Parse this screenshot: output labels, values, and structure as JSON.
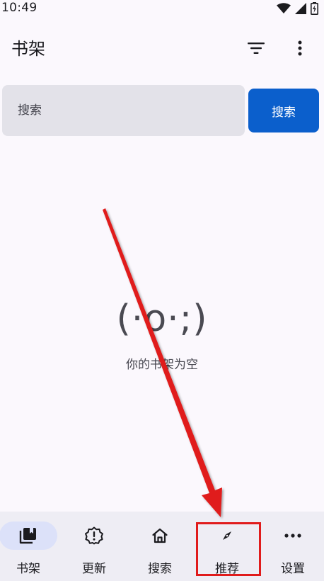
{
  "status_bar": {
    "time": "10:49",
    "icons": [
      "wifi-icon",
      "signal-icon",
      "battery-charging-icon"
    ]
  },
  "app_bar": {
    "title": "书架",
    "actions": [
      "filter-icon",
      "more-vert-icon"
    ]
  },
  "search": {
    "placeholder": "搜索",
    "button_label": "搜索"
  },
  "empty_state": {
    "emoticon": "(·o·;)",
    "message": "你的书架为空"
  },
  "bottom_nav": {
    "items": [
      {
        "label": "书架",
        "icon": "bookshelf-icon",
        "active": true
      },
      {
        "label": "更新",
        "icon": "update-alert-icon",
        "active": false
      },
      {
        "label": "搜索",
        "icon": "home-icon",
        "active": false
      },
      {
        "label": "推荐",
        "icon": "compass-icon",
        "active": false
      },
      {
        "label": "设置",
        "icon": "more-horiz-icon",
        "active": false
      }
    ]
  },
  "annotation": {
    "color": "#e01b1b",
    "target": "推荐"
  },
  "colors": {
    "accent": "#0b5fcc",
    "background": "#fbf8fd",
    "search_field": "#e3e2e9",
    "nav_background": "#eeedf4",
    "nav_active_pill": "#dce1f9"
  }
}
